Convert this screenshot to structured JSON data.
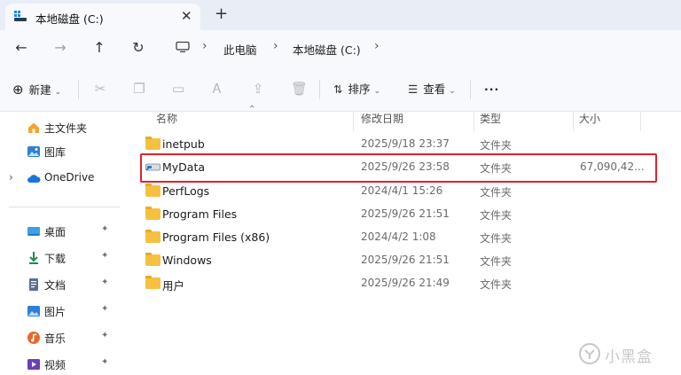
{
  "tab": {
    "title": "本地磁盘 (C:)",
    "close": "✕",
    "new": "+"
  },
  "nav": {
    "back": "←",
    "forward": "→",
    "up": "↑",
    "refresh": "↻",
    "sep": "›"
  },
  "breadcrumb": [
    "此电脑",
    "本地磁盘 (C:)"
  ],
  "commands": {
    "new_label": "新建",
    "sort_label": "排序",
    "view_label": "查看",
    "more_label": "···"
  },
  "sidebar": {
    "top": [
      {
        "label": "主文件夹",
        "icon": "home-icon"
      },
      {
        "label": "图库",
        "icon": "gallery-icon"
      },
      {
        "label": "OneDrive",
        "icon": "cloud-icon"
      }
    ],
    "pinned": [
      {
        "label": "桌面",
        "icon": "desktop-icon"
      },
      {
        "label": "下载",
        "icon": "download-icon"
      },
      {
        "label": "文档",
        "icon": "documents-icon"
      },
      {
        "label": "图片",
        "icon": "pictures-icon"
      },
      {
        "label": "音乐",
        "icon": "music-icon"
      },
      {
        "label": "视频",
        "icon": "videos-icon"
      }
    ],
    "pin_glyph": "📌"
  },
  "columns": {
    "name": "名称",
    "modified": "修改日期",
    "type": "类型",
    "size": "大小"
  },
  "files": [
    {
      "name": "inetpub",
      "modified": "2025/9/18 23:37",
      "type": "文件夹",
      "size": "",
      "icon": "folder-icon"
    },
    {
      "name": "MyData",
      "modified": "2025/9/26 23:58",
      "type": "文件夹",
      "size": "67,090,42...",
      "icon": "drive-link-icon"
    },
    {
      "name": "PerfLogs",
      "modified": "2024/4/1 15:26",
      "type": "文件夹",
      "size": "",
      "icon": "folder-icon"
    },
    {
      "name": "Program Files",
      "modified": "2025/9/26 21:51",
      "type": "文件夹",
      "size": "",
      "icon": "folder-icon"
    },
    {
      "name": "Program Files (x86)",
      "modified": "2024/4/2 1:08",
      "type": "文件夹",
      "size": "",
      "icon": "folder-icon"
    },
    {
      "name": "Windows",
      "modified": "2025/9/26 21:51",
      "type": "文件夹",
      "size": "",
      "icon": "folder-icon"
    },
    {
      "name": "用户",
      "modified": "2025/9/26 21:49",
      "type": "文件夹",
      "size": "",
      "icon": "folder-icon"
    }
  ],
  "watermark": {
    "text": "小黑盒"
  },
  "colors": {
    "accent": "#0067c0",
    "highlight": "#e0232b",
    "folder": "#f6c141"
  }
}
